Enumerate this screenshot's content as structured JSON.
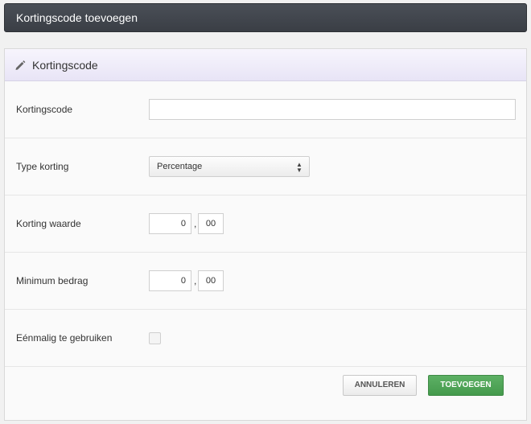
{
  "window": {
    "title": "Kortingscode toevoegen"
  },
  "panel": {
    "title": "Kortingscode",
    "icon": "pencil-icon"
  },
  "form": {
    "code": {
      "label": "Kortingscode",
      "value": ""
    },
    "type": {
      "label": "Type korting",
      "selected": "Percentage",
      "arrows": "▲▼"
    },
    "value": {
      "label": "Korting waarde",
      "integer": "0",
      "separator": ",",
      "decimals": "00"
    },
    "minimum": {
      "label": "Minimum bedrag",
      "integer": "0",
      "separator": ",",
      "decimals": "00"
    },
    "single_use": {
      "label": "Eénmalig te gebruiken",
      "checked": false
    }
  },
  "actions": {
    "cancel_label": "ANNULEREN",
    "add_label": "TOEVOEGEN"
  },
  "colors": {
    "titlebar": "#3f434a",
    "panel_header": "#ece8f8",
    "primary_button": "#4ea656"
  }
}
